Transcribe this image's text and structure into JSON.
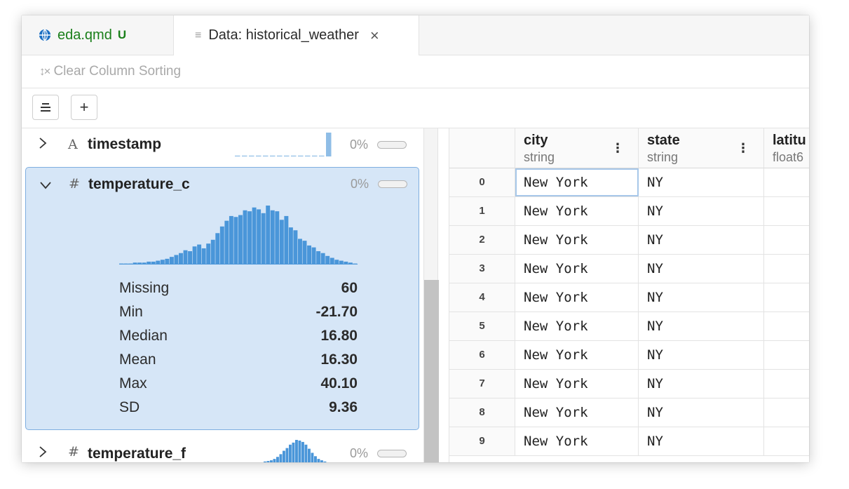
{
  "tabs": [
    {
      "label": "eda.qmd",
      "status": "U",
      "icon": "globe-icon",
      "color": "#1a7f1a"
    },
    {
      "label": "Data: historical_weather",
      "icon": "data-lines-icon",
      "close": "×"
    }
  ],
  "toolbar": {
    "sort_icon": "↕×",
    "clear_sorting_label": "Clear Column Sorting"
  },
  "buttons": {
    "collapse_glyph": "☰",
    "add_glyph": "+"
  },
  "summary": {
    "columns": [
      {
        "name": "timestamp",
        "type_glyph": "A",
        "missing_pct": "0%",
        "expanded": false,
        "chevron": "›"
      },
      {
        "name": "temperature_c",
        "type_glyph": "#",
        "missing_pct": "0%",
        "expanded": true,
        "chevron": "⌄"
      },
      {
        "name": "temperature_f",
        "type_glyph": "#",
        "missing_pct": "0%",
        "expanded": false,
        "chevron": "›"
      }
    ],
    "stats": [
      {
        "label": "Missing",
        "value": "60"
      },
      {
        "label": "Min",
        "value": "-21.70"
      },
      {
        "label": "Median",
        "value": "16.80"
      },
      {
        "label": "Mean",
        "value": "16.30"
      },
      {
        "label": "Max",
        "value": "40.10"
      },
      {
        "label": "SD",
        "value": "9.36"
      }
    ],
    "histogram_color": "#4a96d9",
    "timestamp_bins": [
      1,
      1,
      1,
      1,
      1,
      1,
      1,
      1,
      1,
      1,
      1,
      1,
      1,
      30
    ],
    "temperature_c_bins": [
      1,
      1,
      1,
      2,
      2,
      2,
      3,
      3,
      4,
      5,
      6,
      8,
      10,
      12,
      15,
      14,
      19,
      21,
      17,
      22,
      26,
      33,
      40,
      46,
      51,
      50,
      52,
      57,
      56,
      60,
      58,
      54,
      62,
      57,
      56,
      47,
      51,
      39,
      36,
      27,
      25,
      20,
      18,
      14,
      12,
      9,
      7,
      5,
      4,
      3,
      2,
      1
    ],
    "temperature_f_bins": [
      1,
      2,
      3,
      5,
      8,
      12,
      17,
      21,
      26,
      29,
      33,
      32,
      30,
      26,
      20,
      14,
      9,
      5,
      3,
      1
    ]
  },
  "grid": {
    "columns": [
      {
        "name": "city",
        "type": "string"
      },
      {
        "name": "state",
        "type": "string"
      },
      {
        "name": "latitu",
        "type": "float6"
      }
    ],
    "rows": [
      {
        "index": "0",
        "city": "New York",
        "state": "NY"
      },
      {
        "index": "1",
        "city": "New York",
        "state": "NY"
      },
      {
        "index": "2",
        "city": "New York",
        "state": "NY"
      },
      {
        "index": "3",
        "city": "New York",
        "state": "NY"
      },
      {
        "index": "4",
        "city": "New York",
        "state": "NY"
      },
      {
        "index": "5",
        "city": "New York",
        "state": "NY"
      },
      {
        "index": "6",
        "city": "New York",
        "state": "NY"
      },
      {
        "index": "7",
        "city": "New York",
        "state": "NY"
      },
      {
        "index": "8",
        "city": "New York",
        "state": "NY"
      },
      {
        "index": "9",
        "city": "New York",
        "state": "NY"
      }
    ],
    "kebab_glyph": "⋮"
  }
}
